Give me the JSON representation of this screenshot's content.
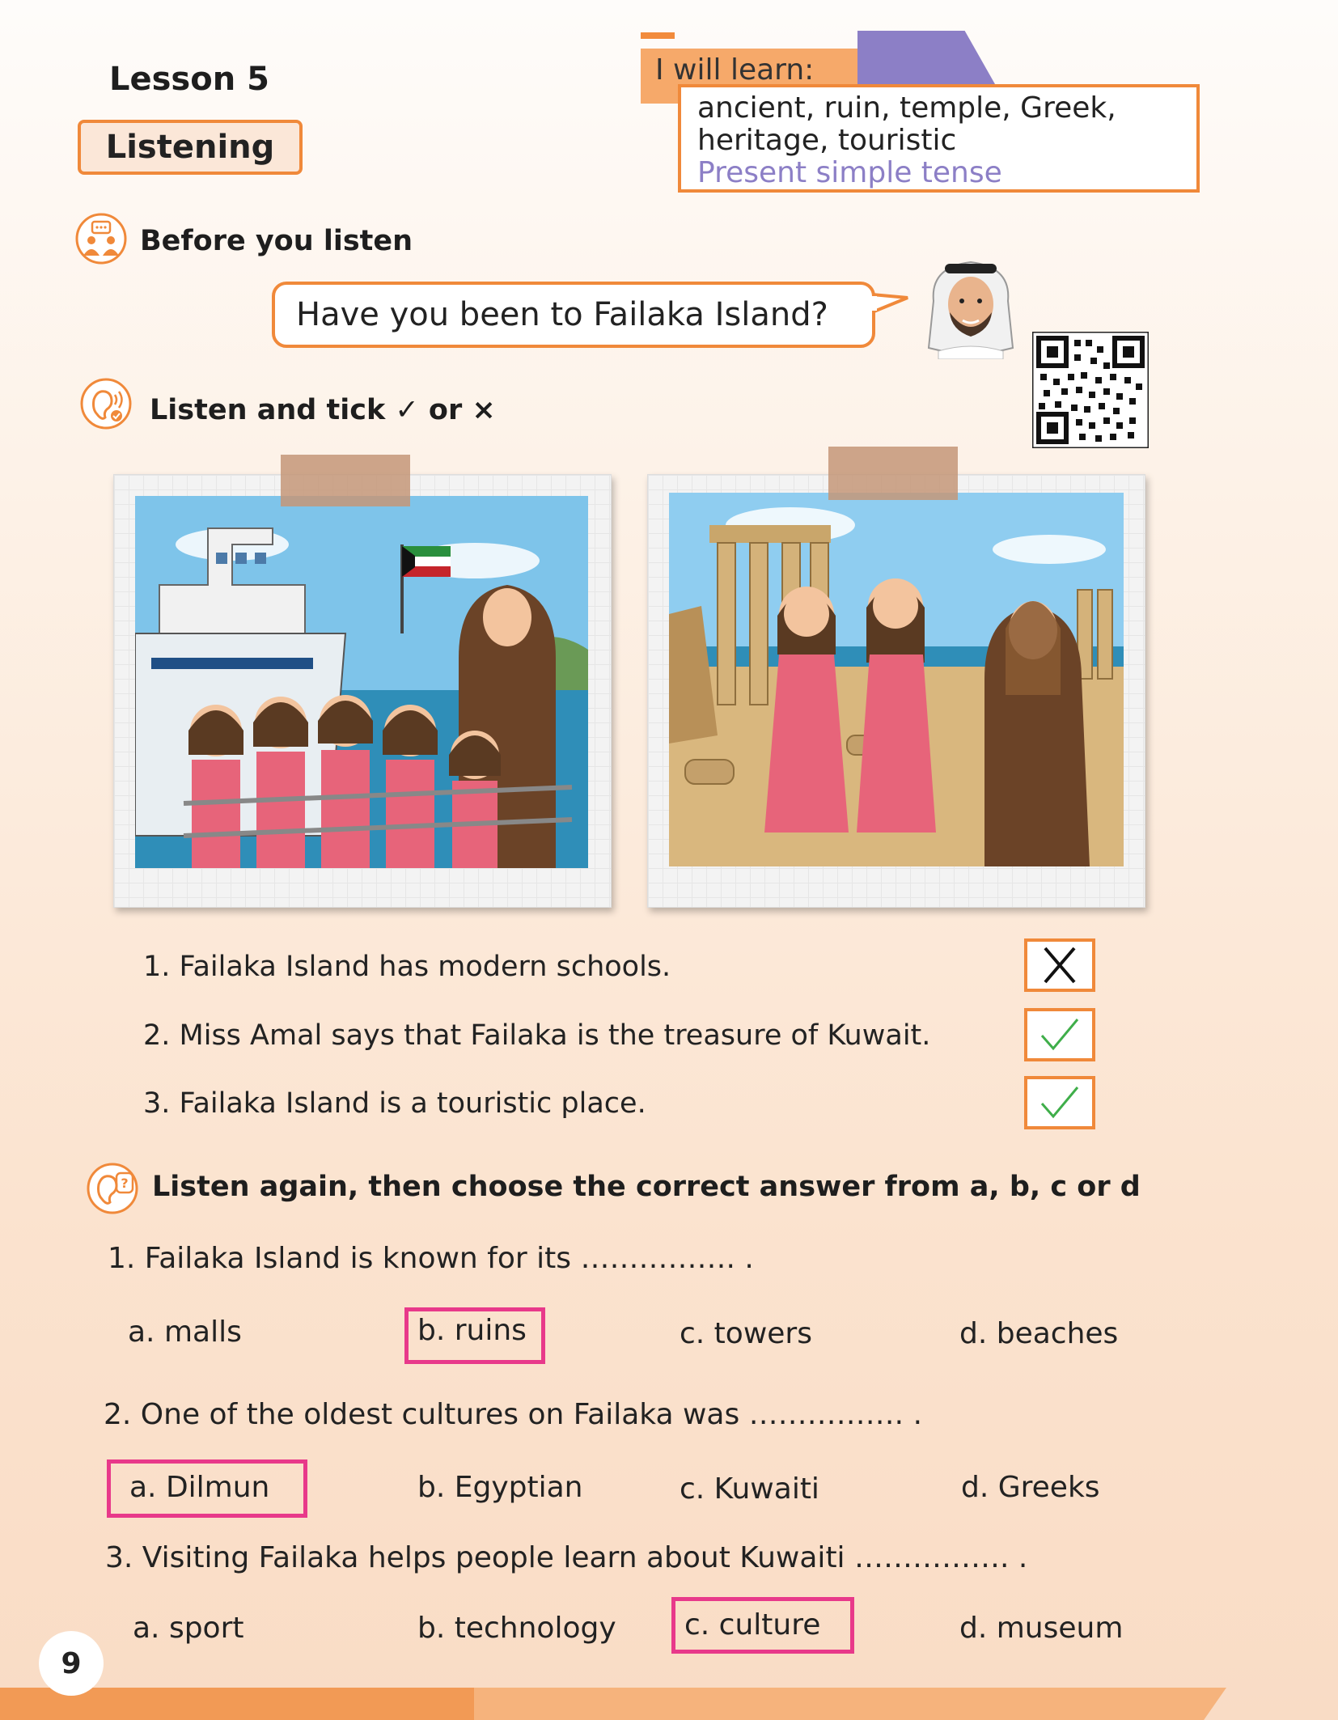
{
  "header": {
    "lesson": "Lesson 5",
    "skill": "Listening",
    "learn_label": "I will learn:",
    "learn_line1": "ancient, ruin, temple, Greek,",
    "learn_line2": "heritage, touristic",
    "learn_tense": "Present simple tense"
  },
  "before": {
    "title": "Before you listen",
    "question": "Have you been to Failaka Island?"
  },
  "tick_section": {
    "title": "Listen and tick ✓ or ×",
    "items": [
      {
        "text": "1. Failaka Island has modern schools.",
        "answer": "×"
      },
      {
        "text": "2. Miss Amal says that Failaka is the treasure of Kuwait.",
        "answer": "✓"
      },
      {
        "text": "3. Failaka Island is a touristic place.",
        "answer": "✓"
      }
    ]
  },
  "mcq_section": {
    "title": "Listen again, then choose the correct answer from a, b, c or d",
    "questions": [
      {
        "text": "1. Failaka Island is known for its ……………. .",
        "options": [
          "a. malls",
          "b. ruins",
          "c. towers",
          "d. beaches"
        ],
        "answer_index": 1
      },
      {
        "text": "2. One of the oldest cultures on Failaka was ……………. .",
        "options": [
          "a. Dilmun",
          "b. Egyptian",
          "c. Kuwaiti",
          "d. Greeks"
        ],
        "answer_index": 0
      },
      {
        "text": "3. Visiting Failaka helps people learn about Kuwaiti ……………. .",
        "options": [
          "a. sport",
          "b. technology",
          "c. culture",
          "d. museum"
        ],
        "answer_index": 2
      }
    ]
  },
  "page_number": "9",
  "colors": {
    "accent": "#f0893a",
    "purple": "#8c7fc6",
    "answer_highlight": "#e8398a",
    "tick_green": "#3fae4a"
  }
}
